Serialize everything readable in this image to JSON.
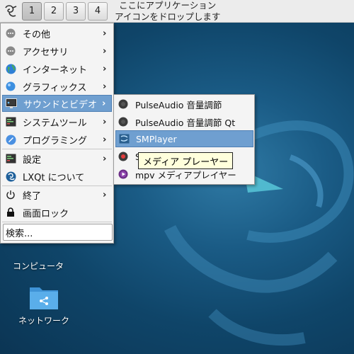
{
  "panel": {
    "workspaces": [
      "1",
      "2",
      "3",
      "4"
    ],
    "active_workspace": "1",
    "drop_hint_line1": "ここにアプリケーション",
    "drop_hint_line2": "アイコンをドロップします"
  },
  "menu": {
    "items": [
      {
        "label": "その他",
        "icon": "other-icon"
      },
      {
        "label": "アクセサリ",
        "icon": "accessories-icon"
      },
      {
        "label": "インターネット",
        "icon": "internet-globe-icon"
      },
      {
        "label": "グラフィックス",
        "icon": "graphics-icon"
      },
      {
        "label": "サウンドとビデオ",
        "icon": "multimedia-icon"
      },
      {
        "label": "システムツール",
        "icon": "system-tools-icon"
      },
      {
        "label": "プログラミング",
        "icon": "programming-icon"
      },
      {
        "label": "設定",
        "icon": "settings-icon"
      },
      {
        "label": "LXQt について",
        "icon": "lxqt-logo-icon"
      },
      {
        "label": "終了",
        "icon": "power-icon"
      },
      {
        "label": "画面ロック",
        "icon": "lock-icon"
      }
    ],
    "search_label": "検索..."
  },
  "submenu": {
    "items": [
      {
        "label": "PulseAudio 音量調節",
        "icon": "speaker-icon"
      },
      {
        "label": "PulseAudio 音量調節 Qt",
        "icon": "speaker-icon"
      },
      {
        "label": "SMPlayer",
        "icon": "smplayer-icon"
      },
      {
        "label": "S",
        "icon": "record-icon"
      },
      {
        "label": "mpv メディアプレイヤー",
        "icon": "mpv-icon"
      }
    ]
  },
  "tooltip": {
    "text": "メディア プレーヤー"
  },
  "desktop": {
    "network_label": "ネットワーク",
    "partial_label": "コンピュータ"
  },
  "colors": {
    "menu_highlight": "#6f9fd0",
    "desktop_bg": "#1a5b85"
  }
}
